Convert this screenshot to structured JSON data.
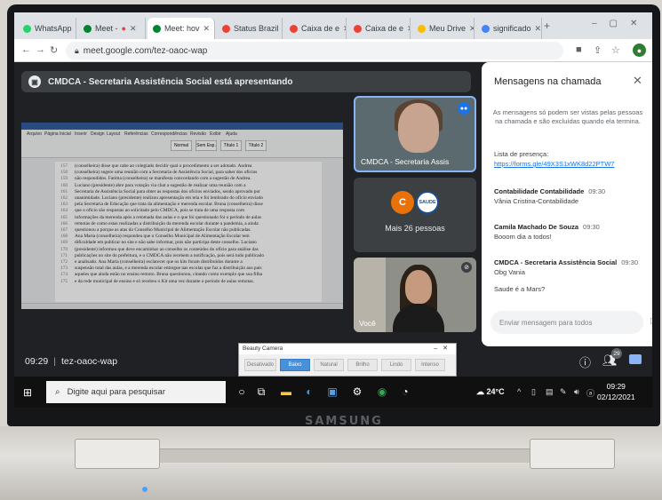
{
  "device": {
    "brand": "SAMSUNG"
  },
  "browser": {
    "tabs": [
      {
        "label": "WhatsApp",
        "favicon_color": "#25d366"
      },
      {
        "label": "Meet -",
        "favicon_color": "#00832d"
      },
      {
        "label": "Meet: hov",
        "favicon_color": "#00832d"
      },
      {
        "label": "Status Brazil",
        "favicon_color": "#ea4335"
      },
      {
        "label": "Caixa de e",
        "favicon_color": "#ea4335"
      },
      {
        "label": "Caixa de e",
        "favicon_color": "#ea4335"
      },
      {
        "label": "Meu Drive",
        "favicon_color": "#fbbc04"
      },
      {
        "label": "significado",
        "favicon_color": "#4285f4"
      }
    ],
    "new_tab": "+",
    "url": "meet.google.com/tez-oaoc-wap"
  },
  "meet": {
    "presenting_banner": "CMDCA - Secretaria Assistência Social está apresentando",
    "participants": {
      "tile1_name": "CMDCA - Secretaria Assis",
      "tile2_avatar": "C",
      "tile2_logo": "SAUDE",
      "more_people": "Mais 26 pessoas",
      "tile3_name": "Você"
    },
    "meeting_time": "09:29",
    "meeting_code": "tez-oaoc-wap",
    "participants_count": "29"
  },
  "chat": {
    "title": "Mensagens na chamada",
    "note": "As mensagens só podem ser vistas pelas pessoas na chamada e são excluídas quando ela termina.",
    "messages": [
      {
        "sender": "",
        "time": "",
        "text": "Lista de presença:",
        "link": "https://forms.gle/49X3S1xWK8d22PTW7"
      },
      {
        "sender": "Contabilidade Contabilidade",
        "time": "09:30",
        "text": "Vânia Cristina-Contabilidade",
        "link": ""
      },
      {
        "sender": "Camila Machado De Souza",
        "time": "09:30",
        "text": "Booom dia a todos!",
        "link": ""
      },
      {
        "sender": "CMDCA - Secretaria Assistência Social",
        "time": "09:30",
        "text": "Obg Vania",
        "link": ""
      },
      {
        "sender": "",
        "time": "",
        "text": "Saude é a Mars?",
        "link": ""
      }
    ],
    "input_placeholder": "Enviar mensagem para todos"
  },
  "document": {
    "ribbon_tabs": [
      "Arquivo",
      "Página Inicial",
      "Inserir",
      "Design",
      "Layout",
      "Referências",
      "Correspondências",
      "Revisão",
      "Exibir",
      "Ajuda"
    ],
    "styles": [
      "Normal",
      "Sem Esp.",
      "Título 1",
      "Título 2"
    ],
    "lines": [
      {
        "n": "157",
        "t": "(conselheira) disse que cabe ao colegiado decidir qual o procedimento a ser adotado. Andrea"
      },
      {
        "n": "158",
        "t": "(conselheira) sugere uma reunião com a Secretaria de Assistência Social, para saber dos ofícios"
      },
      {
        "n": "159",
        "t": "não respondidos. Fatima (conselheira) se manifesta concordando com a sugestão de Andrea."
      },
      {
        "n": "160",
        "t": "Luciano (presidente) abre para votação via chat a sugestão de realizar uma reunião com a"
      },
      {
        "n": "161",
        "t": "Secretaria de Assistência Social para obter as respostas dos ofícios enviados, sendo aprovado por"
      },
      {
        "n": "162",
        "t": "unanimidade. Luciano (presidente) realizou apresentação em tela e foi lembrado do ofício enviado"
      },
      {
        "n": "163",
        "t": "pela Secretaria de Educação que trata da alimentação e merenda escolar. Bruna (conselheira) disse"
      },
      {
        "n": "164",
        "t": "que o ofício são respostas ao solicitado pelo CMDCA, pois se trata de uma resposta com"
      },
      {
        "n": "165",
        "t": "informações da merenda após a retomada das aulas e o que foi questionado foi o período de aulas"
      },
      {
        "n": "166",
        "t": "remotas de como estas realizadas a distribuição da merenda escolar durante a pandemia, a ainda"
      },
      {
        "n": "167",
        "t": "questionou a porque as atas do Conselho Municipal de Alimentação Escolar não publicadas."
      },
      {
        "n": "168",
        "t": "Ana Maria (conselheira) respondeu que o Conselho Municipal de Alimentação Escolar tem"
      },
      {
        "n": "169",
        "t": "dificuldade em publicar no site e não sabe informar, pois não participa deste conselho. Luciano"
      },
      {
        "n": "170",
        "t": "(presidente) informou que deve encaminhar ao conselho os conteúdos do ofício para análise das"
      },
      {
        "n": "171",
        "t": "publicações no site do prefeitura, e o CMDCA não recebem a notificação, pois será tudo publicado"
      },
      {
        "n": "172",
        "t": "e analisado. Ana Maria (conselheira) esclarecer que os kits foram distribuídos durante a"
      },
      {
        "n": "173",
        "t": "suspensão total das aulas, e a merenda escolar entregue nas escolas que faz a distribuição aos pais"
      },
      {
        "n": "174",
        "t": "aqueles que ainda estão no ensino remoto. Bruna questionou, citando como exemplo que sua filha"
      },
      {
        "n": "175",
        "t": "e da rede municipal de ensino e só recebeu o Kit uma vez durante o período de aulas remotas."
      }
    ]
  },
  "beauty_camera": {
    "title": "Beauty Camera",
    "buttons": [
      "Desativado",
      "Baixo",
      "Natural",
      "Brilho",
      "Lindo",
      "Intenso"
    ],
    "active": "Baixo"
  },
  "taskbar": {
    "search_placeholder": "Digite aqui para pesquisar",
    "weather": "24°C",
    "time": "09:29",
    "date": "02/12/2021"
  },
  "colors": {
    "meet_bg": "#202124",
    "accent": "#1a73e8",
    "taskbar": "#101011"
  }
}
